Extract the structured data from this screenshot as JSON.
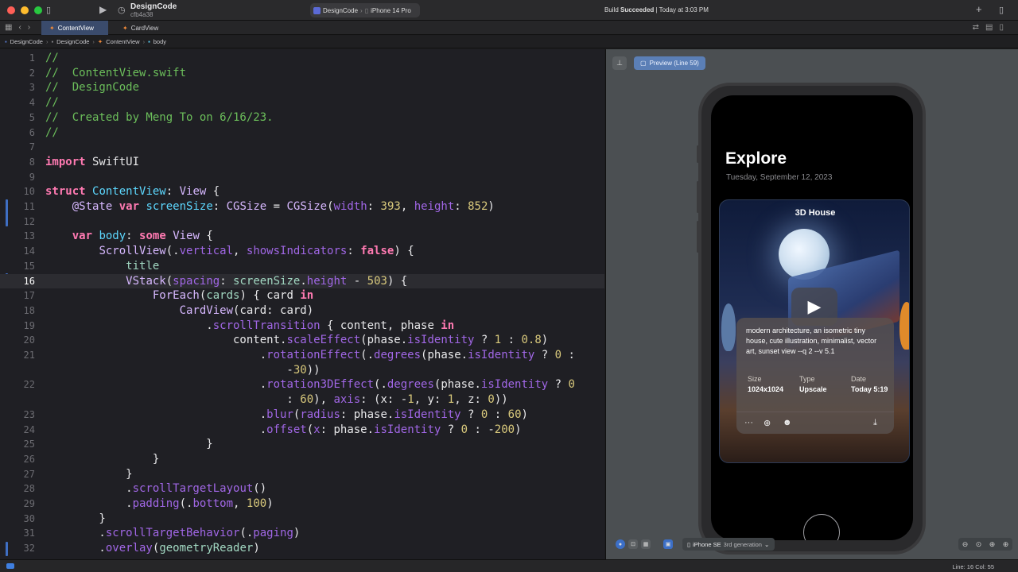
{
  "titlebar": {
    "scheme_name": "DesignCode",
    "scheme_hash": "cfb4a38",
    "destination_project": "DesignCode",
    "destination_device": "iPhone 14 Pro",
    "status_prefix": "Build",
    "status_result": "Succeeded",
    "status_time": "| Today at 3:03 PM"
  },
  "tabs": [
    {
      "label": "ContentView",
      "active": true
    },
    {
      "label": "CardView",
      "active": false
    }
  ],
  "breadcrumb": [
    "DesignCode",
    "DesignCode",
    "ContentView",
    "body"
  ],
  "editor": {
    "current_line": 16,
    "line_numbers": [
      "1",
      "2",
      "3",
      "4",
      "5",
      "6",
      "7",
      "8",
      "9",
      "10",
      "11",
      "12",
      "13",
      "14",
      "15",
      "16",
      "17",
      "18",
      "19",
      "20",
      "21",
      "",
      "22",
      "",
      "23",
      "24",
      "25",
      "26",
      "27",
      "28",
      "29",
      "30",
      "31",
      "32"
    ]
  },
  "preview": {
    "badge": "Preview (Line 59)",
    "app_title": "Explore",
    "app_date": "Tuesday, September 12, 2023",
    "card_title": "3D House",
    "card_desc": "modern architecture, an isometric tiny house, cute illustration, minimalist, vector art, sunset view --q 2 --v 5.1",
    "meta": [
      {
        "key": "Size",
        "value": "1024x1024"
      },
      {
        "key": "Type",
        "value": "Upscale"
      },
      {
        "key": "Date",
        "value": "Today 5:19"
      }
    ],
    "device_name": "iPhone SE",
    "device_gen": "3rd generation"
  },
  "statusbar": {
    "position": "Line: 16  Col: 55"
  },
  "colors": {
    "accent": "#3f6fc4",
    "comment": "#6cbf5b",
    "keyword": "#ff7ab2",
    "number": "#d9c97c"
  }
}
